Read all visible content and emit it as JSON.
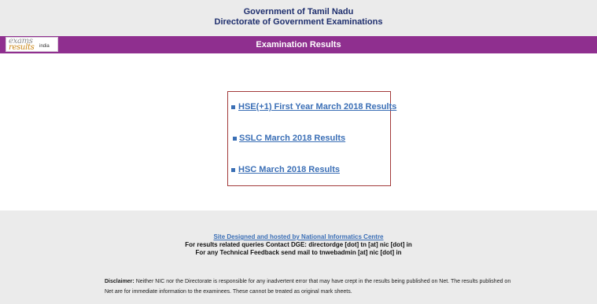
{
  "header": {
    "line1": "Government of Tamil Nadu",
    "line2": "Directorate of Government Examinations"
  },
  "banner": {
    "title": "Examination Results",
    "logo": {
      "word1": "exams",
      "word2": "results",
      "word3": "india"
    }
  },
  "results": {
    "items": [
      {
        "label": "HSE(+1) First Year March 2018 Results"
      },
      {
        "label": "SSLC March 2018 Results"
      },
      {
        "label": "HSC March 2018 Results"
      }
    ]
  },
  "footer": {
    "credit_link": "Site Designed and hosted by National Informatics Centre",
    "contact_line": "For results related queries Contact DGE:  directordge [dot] tn [at] nic [dot] in",
    "feedback_line": "For any Technical Feedback send mail to tnwebadmin [at] nic [dot] in",
    "disclaimer_label": "Disclaimer:",
    "disclaimer_text": "Neither NIC nor the Directorate is responsible for any inadvertent error that may have crept in the results being published on Net. The results published on Net are for immediate information to the examinees. These cannot be treated as original mark sheets."
  },
  "colors": {
    "banner": "#8f2f8f",
    "link": "#3b6fb6",
    "box_border": "#a33b3b",
    "header_text": "#1f2f6e"
  }
}
